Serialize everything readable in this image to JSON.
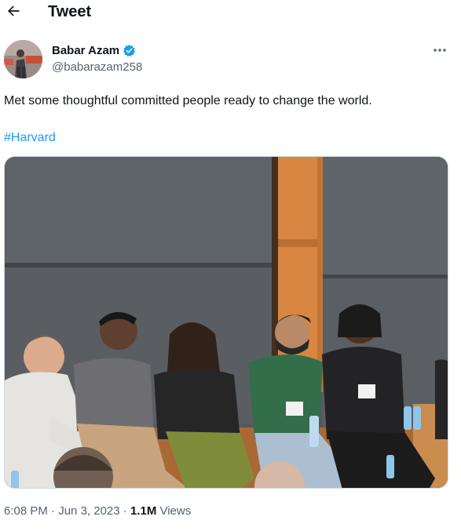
{
  "header": {
    "title": "Tweet",
    "back_icon": "arrow-left-icon"
  },
  "author": {
    "name": "Babar Azam",
    "handle": "@babarazam258",
    "verified": true,
    "verified_color": "#1d9bf0",
    "avatar_icon": "profile-photo"
  },
  "tweet": {
    "text": "Met some thoughtful committed people ready to change the world.",
    "hashtag": "#Harvard",
    "hashtag_color": "#1d9bf0"
  },
  "media": {
    "type": "photo",
    "icon": "photo-panel-discussion"
  },
  "meta": {
    "time": "6:08 PM",
    "separator1": " · ",
    "date": "Jun 3, 2023",
    "separator2": " · ",
    "views_count": "1.1M",
    "views_label": " Views"
  },
  "colors": {
    "text": "#0f1419",
    "secondary": "#536471",
    "accent": "#1d9bf0"
  }
}
